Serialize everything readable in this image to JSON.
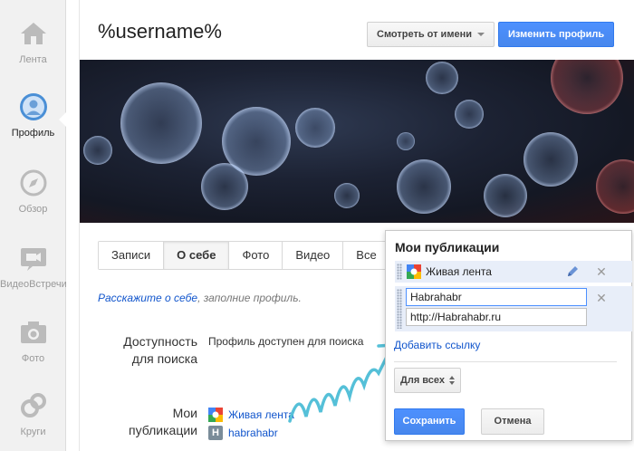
{
  "rail": {
    "items": [
      {
        "label": "Лента",
        "icon": "home-icon"
      },
      {
        "label": "Профиль",
        "icon": "profile-icon"
      },
      {
        "label": "Обзор",
        "icon": "compass-icon"
      },
      {
        "label": "ВидеоВстречи",
        "icon": "video-icon"
      },
      {
        "label": "Фото",
        "icon": "camera-icon"
      },
      {
        "label": "Круги",
        "icon": "circles-icon"
      }
    ]
  },
  "header": {
    "username": "%username%",
    "view_as_label": "Смотреть от имени",
    "edit_profile_label": "Изменить профиль"
  },
  "tabs": [
    {
      "label": "Записи"
    },
    {
      "label": "О себе"
    },
    {
      "label": "Фото"
    },
    {
      "label": "Видео"
    },
    {
      "label": "Все"
    }
  ],
  "about": {
    "prompt_link": "Расскажите о себе",
    "prompt_rest": ", заполние профиль."
  },
  "search": {
    "label_line1": "Доступность",
    "label_line2": "для поиска",
    "value": "Профиль доступен для поиска"
  },
  "publications": {
    "label_line1": "Мои",
    "label_line2": "публикации",
    "items": [
      {
        "name": "Живая лента"
      },
      {
        "name": "habrahabr"
      }
    ]
  },
  "popup": {
    "title": "Мои публикации",
    "first_item": "Живая лента",
    "edit_name_value": "Habrahabr",
    "edit_url_value": "http://Habrahabr.ru",
    "add_link_label": "Добавить ссылку",
    "visibility_label": "Для всех",
    "save_label": "Сохранить",
    "cancel_label": "Отмена"
  },
  "colors": {
    "accent_blue": "#4d90fe",
    "link_blue": "#1155cc",
    "squiggle": "#55c0d8"
  }
}
